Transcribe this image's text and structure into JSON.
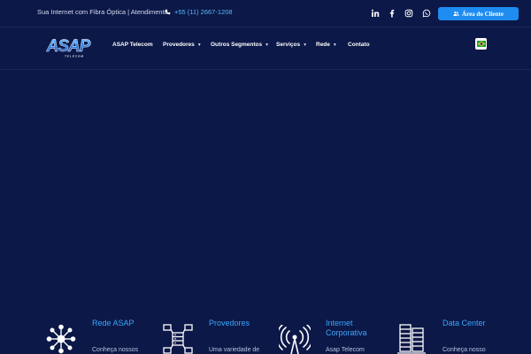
{
  "topbar": {
    "tagline": "Sua Internet com Fibra Óptica | Atendimento",
    "phone": "+55 (11) 2667-1208",
    "social_icons": [
      "linkedin-icon",
      "facebook-icon",
      "instagram-icon",
      "whatsapp-icon"
    ],
    "client_area_label": "Área do Cliente"
  },
  "brand": {
    "logo_text": "ASAP",
    "logo_subtext": "TELECOM"
  },
  "nav": {
    "items": [
      {
        "label": "ASAP Telecom",
        "dropdown": false
      },
      {
        "label": "Provedores",
        "dropdown": true
      },
      {
        "label": "Outros Segmentos",
        "dropdown": true
      },
      {
        "label": "Serviços",
        "dropdown": true
      },
      {
        "label": "Rede",
        "dropdown": true
      },
      {
        "label": "Contato",
        "dropdown": false
      }
    ]
  },
  "features": [
    {
      "title": "Rede ASAP",
      "text": "Conheça nossos",
      "icon": "network-icon"
    },
    {
      "title": "Provedores",
      "text": "Uma variedade de",
      "icon": "servers-network-icon"
    },
    {
      "title": "Internet Corporativa",
      "text": "Asap Telecom",
      "icon": "antenna-icon"
    },
    {
      "title": "Data Center",
      "text": "Conheça nosso",
      "icon": "datacenter-icon"
    }
  ],
  "colors": {
    "background": "#0c1847",
    "accent": "#1e8cf0",
    "feature_title": "#3aa7ff"
  }
}
